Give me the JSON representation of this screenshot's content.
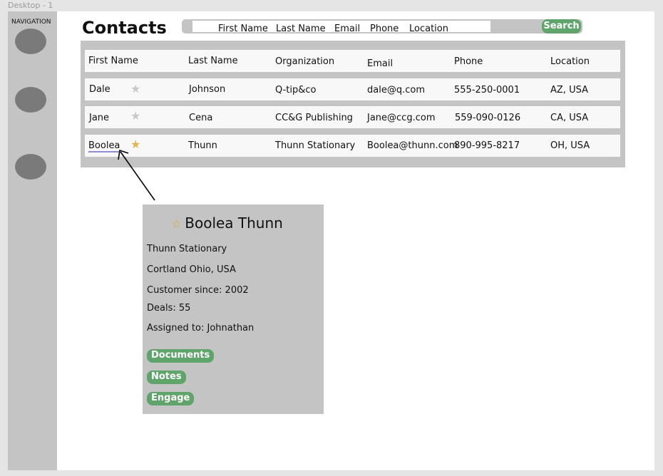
{
  "frame_label": "Desktop - 1",
  "sidebar": {
    "label": "NAVIGATION",
    "items": [
      "",
      "",
      ""
    ]
  },
  "page_title": "Contacts",
  "search": {
    "fields": [
      "First Name",
      "Last Name",
      "Email",
      "Phone",
      "Location"
    ],
    "button_label": "Search"
  },
  "table": {
    "headers": [
      "First Name",
      "Last Name",
      "Organization",
      "Email",
      "Phone",
      "Location"
    ],
    "rows": [
      {
        "first": "Dale",
        "last": "Johnson",
        "org": "Q-tip&co",
        "email": "dale@q.com",
        "phone": "555-250-0001",
        "location": "AZ, USA",
        "starred": false
      },
      {
        "first": "Jane",
        "last": "Cena",
        "org": "CC&G Publishing",
        "email": "Jane@ccg.com",
        "phone": "559-090-0126",
        "location": "CA, USA",
        "starred": false
      },
      {
        "first": "Boolea",
        "last": "Thunn",
        "org": "Thunn Stationary",
        "email": "Boolea@thunn.com",
        "phone": "890-995-8217",
        "location": "OH, USA",
        "starred": true
      }
    ]
  },
  "detail_card": {
    "name": "Boolea Thunn",
    "organization": "Thunn Stationary",
    "location": "Cortland Ohio, USA",
    "customer_since": "Customer since: 2002",
    "deals": "Deals: 55",
    "assigned_to": "Assigned to: Johnathan",
    "buttons": {
      "documents": "Documents",
      "notes": "Notes",
      "engage": "Engage"
    }
  },
  "icons": {
    "star_on": "star-filled-icon",
    "star_off": "star-outline-icon"
  },
  "colors": {
    "accent_green": "#5fa46b",
    "star_gold": "#e3b34d",
    "panel_gray": "#c4c4c4",
    "nav_dot": "#7a7a7a"
  }
}
